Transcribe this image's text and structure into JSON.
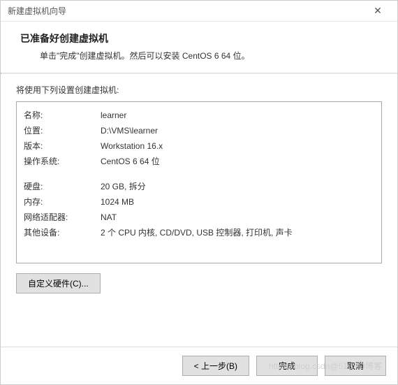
{
  "titlebar": {
    "title": "新建虚拟机向导",
    "close_label": "✕"
  },
  "header": {
    "heading": "已准备好创建虚拟机",
    "subtitle": "单击\"完成\"创建虚拟机。然后可以安装 CentOS 6 64 位。"
  },
  "section_label": "将使用下列设置创建虚拟机:",
  "settings": {
    "group1": [
      {
        "label": "名称:",
        "value": "learner"
      },
      {
        "label": "位置:",
        "value": "D:\\VMS\\learner"
      },
      {
        "label": "版本:",
        "value": "Workstation 16.x"
      },
      {
        "label": "操作系统:",
        "value": "CentOS 6 64 位"
      }
    ],
    "group2": [
      {
        "label": "硬盘:",
        "value": "20 GB, 拆分"
      },
      {
        "label": "内存:",
        "value": "1024 MB"
      },
      {
        "label": "网络适配器:",
        "value": "NAT"
      },
      {
        "label": "其他设备:",
        "value": "2 个 CPU 内核, CD/DVD, USB 控制器, 打印机, 声卡"
      }
    ]
  },
  "buttons": {
    "customize_hw": "自定义硬件(C)...",
    "back": "< 上一步(B)",
    "finish": "完成",
    "cancel": "取消"
  },
  "watermark": "https://blog.csdn@51CTO博客"
}
